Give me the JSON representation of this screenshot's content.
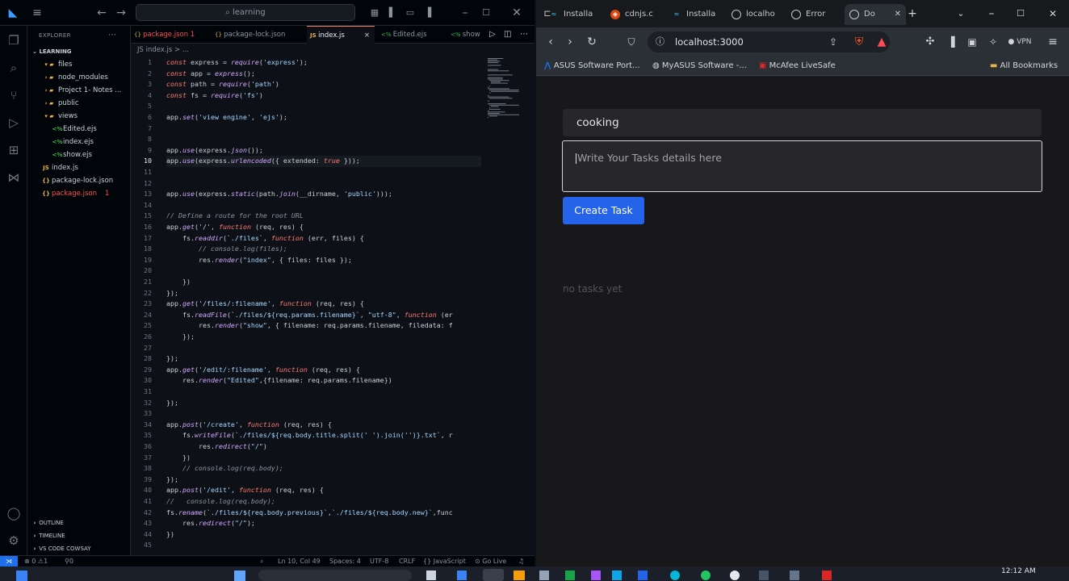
{
  "vscode": {
    "command_center": "learning",
    "explorer_title": "EXPLORER",
    "workspace": "LEARNING",
    "tree": [
      {
        "label": "files",
        "kind": "folder-open",
        "depth": 1
      },
      {
        "label": "node_modules",
        "kind": "folder",
        "depth": 1
      },
      {
        "label": "Project 1- Notes ...",
        "kind": "folder",
        "depth": 1
      },
      {
        "label": "public",
        "kind": "folder",
        "depth": 1
      },
      {
        "label": "views",
        "kind": "folder-open",
        "depth": 1
      },
      {
        "label": "Edited.ejs",
        "kind": "ejs",
        "depth": 2
      },
      {
        "label": "index.ejs",
        "kind": "ejs",
        "depth": 2
      },
      {
        "label": "show.ejs",
        "kind": "ejs",
        "depth": 2
      },
      {
        "label": "index.js",
        "kind": "js",
        "depth": 1
      },
      {
        "label": "package-lock.json",
        "kind": "json",
        "depth": 1
      },
      {
        "label": "package.json",
        "kind": "json",
        "depth": 1,
        "badge": "1"
      }
    ],
    "sections": [
      "OUTLINE",
      "TIMELINE",
      "VS CODE COWSAY"
    ],
    "tabs": [
      {
        "label": "package.json 1",
        "icon": "{}",
        "active": false
      },
      {
        "label": "package-lock.json",
        "icon": "{}",
        "active": false
      },
      {
        "label": "index.js",
        "icon": "JS",
        "active": true
      },
      {
        "label": "Edited.ejs",
        "icon": "<%",
        "active": false
      },
      {
        "label": "show",
        "icon": "<%",
        "active": false
      }
    ],
    "breadcrumb": "JS index.js > ...",
    "code_lines": [
      "const express = require('express');",
      "const app = express();",
      "const path = require('path')",
      "const fs = require('fs')",
      "",
      "app.set('view engine', 'ejs');",
      "",
      "",
      "app.use(express.json());",
      "app.use(express.urlencoded({ extended: true }));",
      "",
      "",
      "app.use(express.static(path.join(__dirname, 'public')));",
      "",
      "// Define a route for the root URL",
      "app.get('/', function (req, res) {",
      "    fs.readdir(`./files`, function (err, files) {",
      "        // console.log(files);",
      "        res.render(\"index\", { files: files });",
      "",
      "    })",
      "});",
      "app.get('/files/:filename', function (req, res) {",
      "    fs.readFile(`./files/${req.params.filename}`, \"utf-8\", function (er",
      "        res.render(\"show\", { filename: req.params.filename, filedata: f",
      "    });",
      "",
      "});",
      "app.get('/edit/:filename', function (req, res) {",
      "    res.render(\"Edited\",{filename: req.params.filename})",
      "",
      "});",
      "",
      "app.post('/create', function (req, res) {",
      "    fs.writeFile(`./files/${req.body.title.split(' ').join('')}.txt`, r",
      "        res.redirect(\"/\")",
      "    })",
      "    // console.log(req.body);",
      "});",
      "app.post('/edit', function (req, res) {",
      "//   console.log(req.body);",
      "fs.rename(`./files/${req.body.previous}`,`./files/${req.body.new}`,func",
      "    res.redirect(\"/\");",
      "})",
      ""
    ],
    "status": {
      "errors": "0",
      "warnings": "1",
      "ports": "0",
      "position": "Ln 10, Col 49",
      "spaces": "Spaces: 4",
      "encoding": "UTF-8",
      "eol": "CRLF",
      "language": "{} JavaScript",
      "golive": "Go Live"
    }
  },
  "browser": {
    "tabs": [
      {
        "label": "Installa",
        "icon": "tailwind",
        "active": false
      },
      {
        "label": "cdnjs.c",
        "icon": "cdnjs",
        "active": false
      },
      {
        "label": "Installa",
        "icon": "tailwind",
        "active": false
      },
      {
        "label": "localho",
        "icon": "globe",
        "active": false
      },
      {
        "label": "Error",
        "icon": "globe",
        "active": false
      },
      {
        "label": "Do",
        "icon": "globe",
        "active": true
      }
    ],
    "url": "localhost:3000",
    "vpn": "VPN",
    "bookmarks": [
      "ASUS Software Port...",
      "MyASUS Software -...",
      "McAfee LiveSafe"
    ],
    "all_bookmarks": "All Bookmarks",
    "page": {
      "title_value": "cooking",
      "details_placeholder": "Write Your Tasks details here",
      "create_label": "Create Task",
      "empty_text": "no tasks yet"
    }
  },
  "taskbar": {
    "time": "12:12 AM"
  },
  "colors": {
    "accent": "#2563eb",
    "keyword": "#ff7b72",
    "function": "#d2a8ff",
    "string": "#a5d6ff",
    "comment": "#8b949e"
  }
}
